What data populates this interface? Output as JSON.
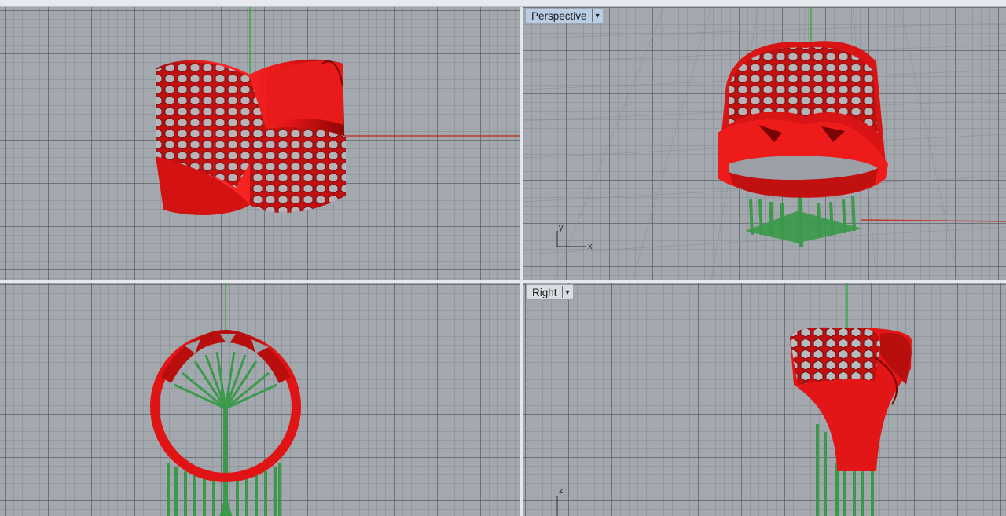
{
  "viewports": {
    "top": {
      "label": ""
    },
    "perspective": {
      "label": "Perspective",
      "dropdown_icon": "triangle-down",
      "active": true
    },
    "front": {
      "label": ""
    },
    "right": {
      "label": "Right",
      "dropdown_icon": "triangle-down",
      "active": false
    }
  },
  "axes": {
    "perspective": {
      "x": "x",
      "y": "y"
    },
    "right": {
      "z": "z"
    }
  },
  "colors": {
    "model": "#e01414",
    "supports": "#3a9a4a",
    "x_axis": "#c0392b",
    "y_axis": "#3aa84a",
    "grid_bg": "#a3a8ae",
    "active_label_bg": "#b9cde4"
  }
}
